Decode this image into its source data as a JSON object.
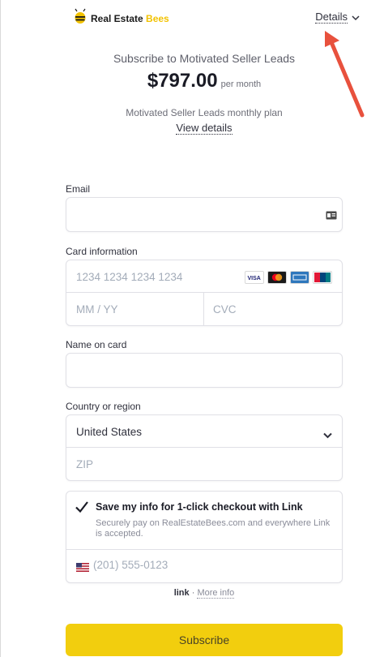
{
  "brand": {
    "name_part1": "Real Estate",
    "name_part2": "Bees",
    "accent": "#f2c200"
  },
  "header": {
    "details_label": "Details"
  },
  "summary": {
    "subtitle": "Subscribe to Motivated Seller Leads",
    "price": "$797.00",
    "period": "per month",
    "plan": "Motivated Seller Leads monthly plan",
    "view_details": "View details"
  },
  "email": {
    "label": "Email",
    "value": ""
  },
  "card": {
    "label": "Card information",
    "number_placeholder": "1234 1234 1234 1234",
    "expiry_placeholder": "MM / YY",
    "cvc_placeholder": "CVC",
    "brands": [
      "visa-icon",
      "mastercard-icon",
      "amex-icon",
      "unionpay-icon"
    ]
  },
  "name": {
    "label": "Name on card",
    "value": ""
  },
  "country": {
    "label": "Country or region",
    "selected": "United States",
    "zip_placeholder": "ZIP"
  },
  "link": {
    "checkbox_label": "Save my info for 1-click checkout with Link",
    "description": "Securely pay on RealEstateBees.com and everywhere Link is accepted.",
    "phone_placeholder": "(201) 555-0123",
    "checked": true,
    "footer_link_word": "link",
    "footer_sep": "·",
    "more_info": "More info"
  },
  "subscribe": {
    "label": "Subscribe",
    "color": "#f2ce0e"
  }
}
